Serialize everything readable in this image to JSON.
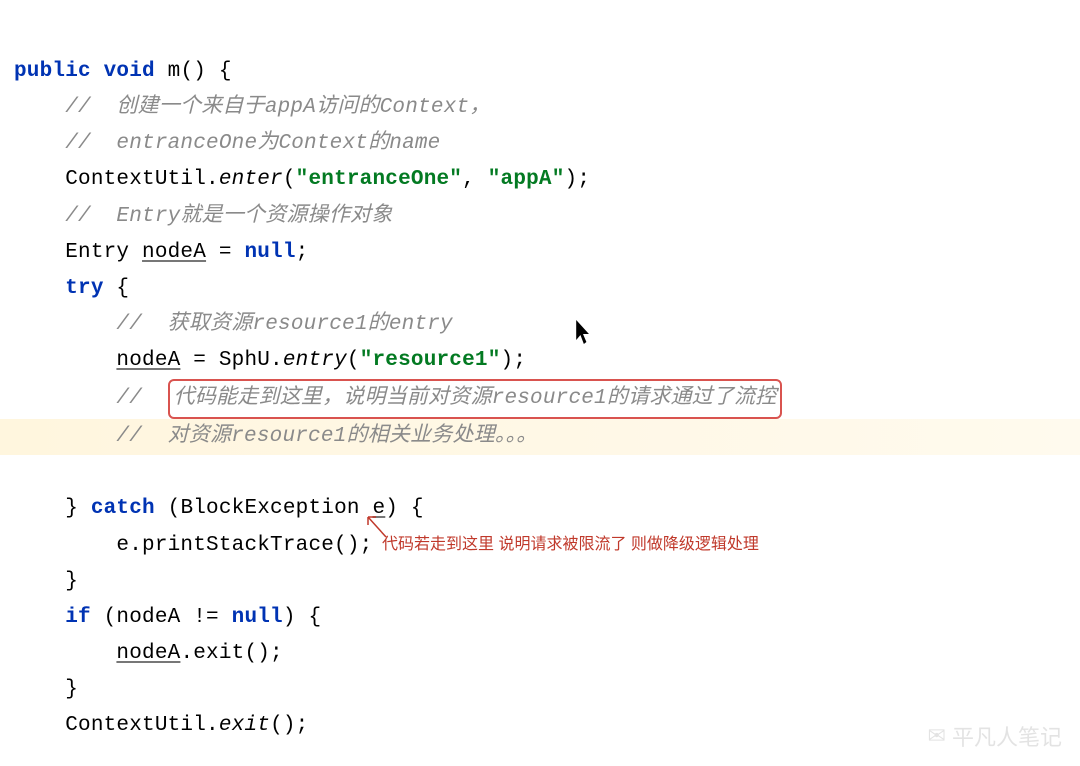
{
  "code": {
    "sig": {
      "public": "public",
      "void": "void",
      "name": "m",
      "parens": "()",
      "brace": "{"
    },
    "c1": "//  创建一个来自于appA访问的Context，",
    "c2": "//  entranceOne为Context的name",
    "l3": {
      "cls": "ContextUtil.",
      "m": "enter",
      "open": "(",
      "s1": "\"entranceOne\"",
      "comma": ", ",
      "s2": "\"appA\"",
      "close": ");"
    },
    "c4": "//  Entry就是一个资源操作对象",
    "l5": {
      "type": "Entry ",
      "var": "nodeA",
      "rest": " = ",
      "null": "null",
      "semi": ";"
    },
    "l6": {
      "try": "try",
      "brace": " {"
    },
    "c7": "//  获取资源resource1的entry",
    "l8": {
      "var": "nodeA",
      "eq": " = SphU.",
      "m": "entry",
      "open": "(",
      "s": "\"resource1\"",
      "close": ");"
    },
    "c9pre": "//  ",
    "c9box": "代码能走到这里，说明当前对资源resource1的请求通过了流控",
    "c10": "//  对资源resource1的相关业务处理。。。",
    "l11": {
      "close": "} ",
      "catch": "catch",
      "open": " (BlockException ",
      "e": "e",
      "close2": ") {"
    },
    "l12": "e.printStackTrace();",
    "l13": "}",
    "l14": {
      "if": "if",
      "cond": " (nodeA != ",
      "null": "null",
      "close": ") {"
    },
    "l15": {
      "var": "nodeA",
      "rest": ".exit();"
    },
    "l16": "}",
    "l17": {
      "cls": "ContextUtil.",
      "m": "exit",
      "rest": "();"
    }
  },
  "annotation": "代码若走到这里 说明请求被限流了 则做降级逻辑处理",
  "watermark": "平凡人笔记"
}
